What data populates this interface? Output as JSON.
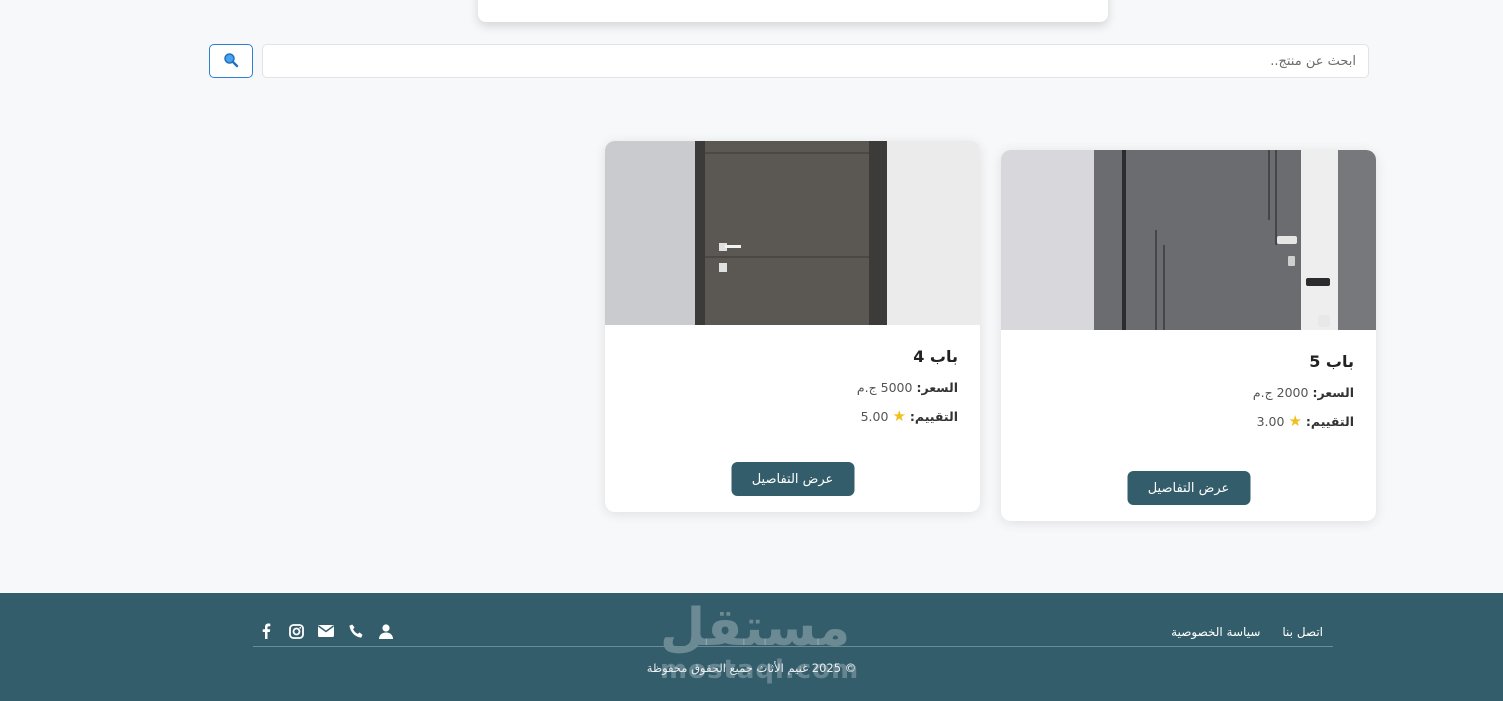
{
  "search": {
    "placeholder": "ابحث عن منتج..",
    "button_icon": "magnifier-icon"
  },
  "products": [
    {
      "title": "باب 5",
      "price_label": "السعر:",
      "price_value": "2000 ج.م",
      "rating_label": "التقييم:",
      "rating_value": "3.00",
      "button_label": "عرض التفاصيل"
    },
    {
      "title": "باب 4",
      "price_label": "السعر:",
      "price_value": "5000 ج.م",
      "rating_label": "التقييم:",
      "rating_value": "5.00",
      "button_label": "عرض التفاصيل"
    }
  ],
  "footer": {
    "links": [
      "اتصل بنا",
      "سياسة الخصوصية"
    ],
    "icons": [
      "facebook-icon",
      "instagram-icon",
      "mail-icon",
      "phone-icon",
      "user-icon"
    ],
    "copyright": "© 2025 غنيم الأثاث جميع الحقوق محفوظة",
    "watermark_ar": "مستقل",
    "watermark_en": "mostaql.com"
  },
  "colors": {
    "accent": "#335d6b",
    "search_border": "#2f7fd0",
    "star": "#f2c01e"
  }
}
